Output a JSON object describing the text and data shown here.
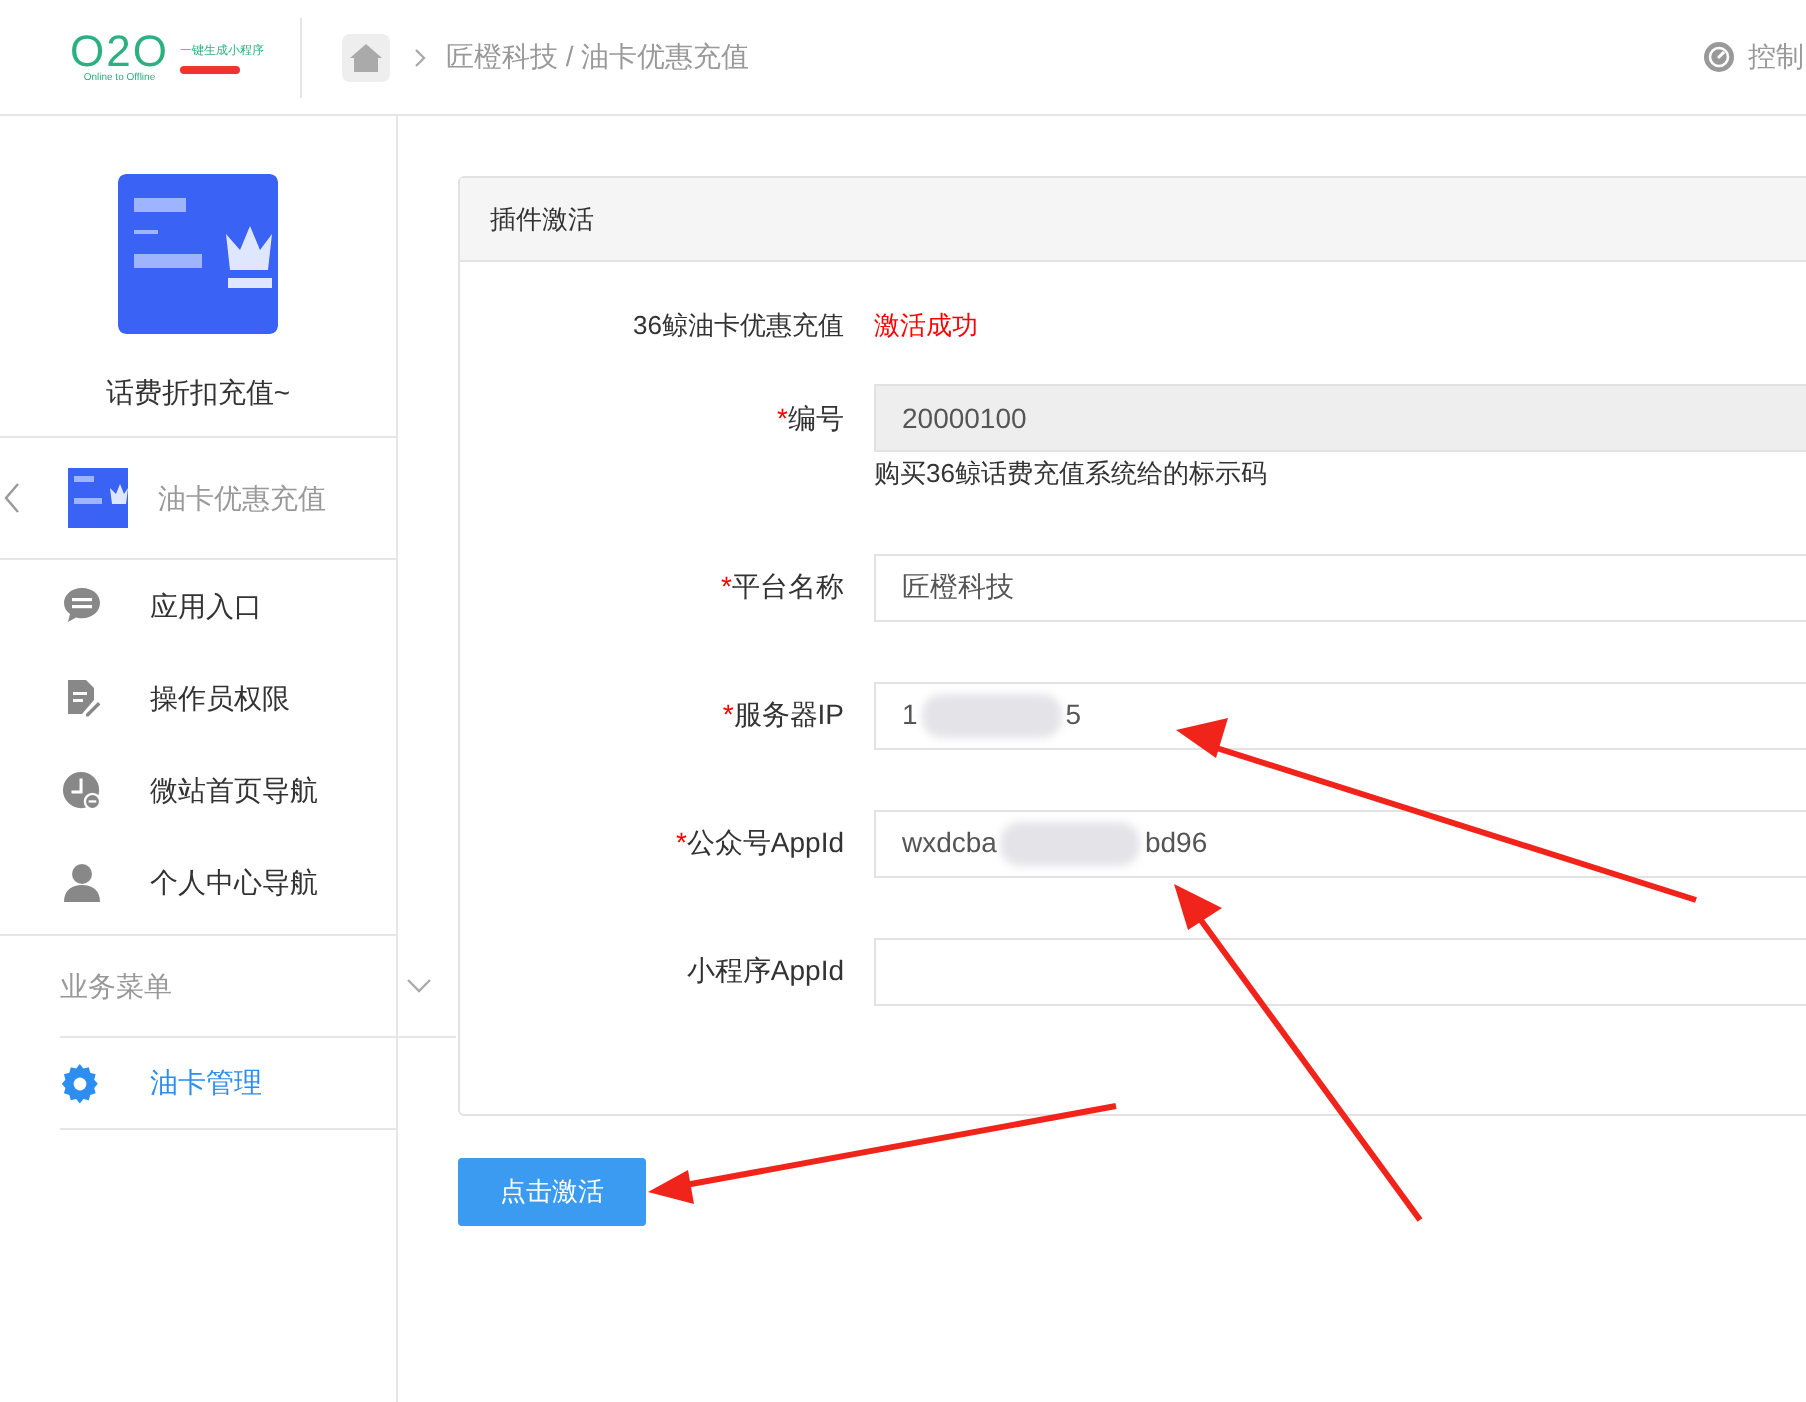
{
  "header": {
    "logo": {
      "mark": "O2O",
      "tagline": "Online to Offline",
      "slogan": "一键生成小程序"
    },
    "breadcrumb": "匠橙科技 / 油卡优惠充值",
    "control": "控制"
  },
  "sidebar": {
    "banner": {
      "kind": "picture",
      "caption": "话费折扣充值~"
    },
    "app": {
      "title": "油卡优惠充值"
    },
    "items": [
      {
        "label": "应用入口"
      },
      {
        "label": "操作员权限"
      },
      {
        "label": "微站首页导航"
      },
      {
        "label": "个人中心导航"
      }
    ],
    "section": {
      "title": "业务菜单",
      "expanded": true,
      "items": [
        {
          "label": "油卡管理",
          "selected": true
        }
      ]
    }
  },
  "panel": {
    "title": "插件激活",
    "status": {
      "label": "36鲸油卡优惠充值",
      "value": "激活成功"
    },
    "fields": [
      {
        "label": "编号",
        "marker": "*",
        "disabled": true,
        "value": "20000100",
        "help": "购买36鲸话费充值系统给的标示码"
      },
      {
        "label": "平台名称",
        "marker": "*",
        "disabled": false,
        "value": "匠橙科技"
      },
      {
        "label": "服务器IP",
        "marker": "*",
        "disabled": false,
        "value": "1",
        "redacted": true,
        "value_end": "5"
      },
      {
        "label": "公众号AppId",
        "marker": "*",
        "disabled": false,
        "value": "wxdcba",
        "redacted": true,
        "value_end": "bd96"
      },
      {
        "label": "小程序AppId",
        "disabled": false
      }
    ]
  },
  "button": "点击激活"
}
